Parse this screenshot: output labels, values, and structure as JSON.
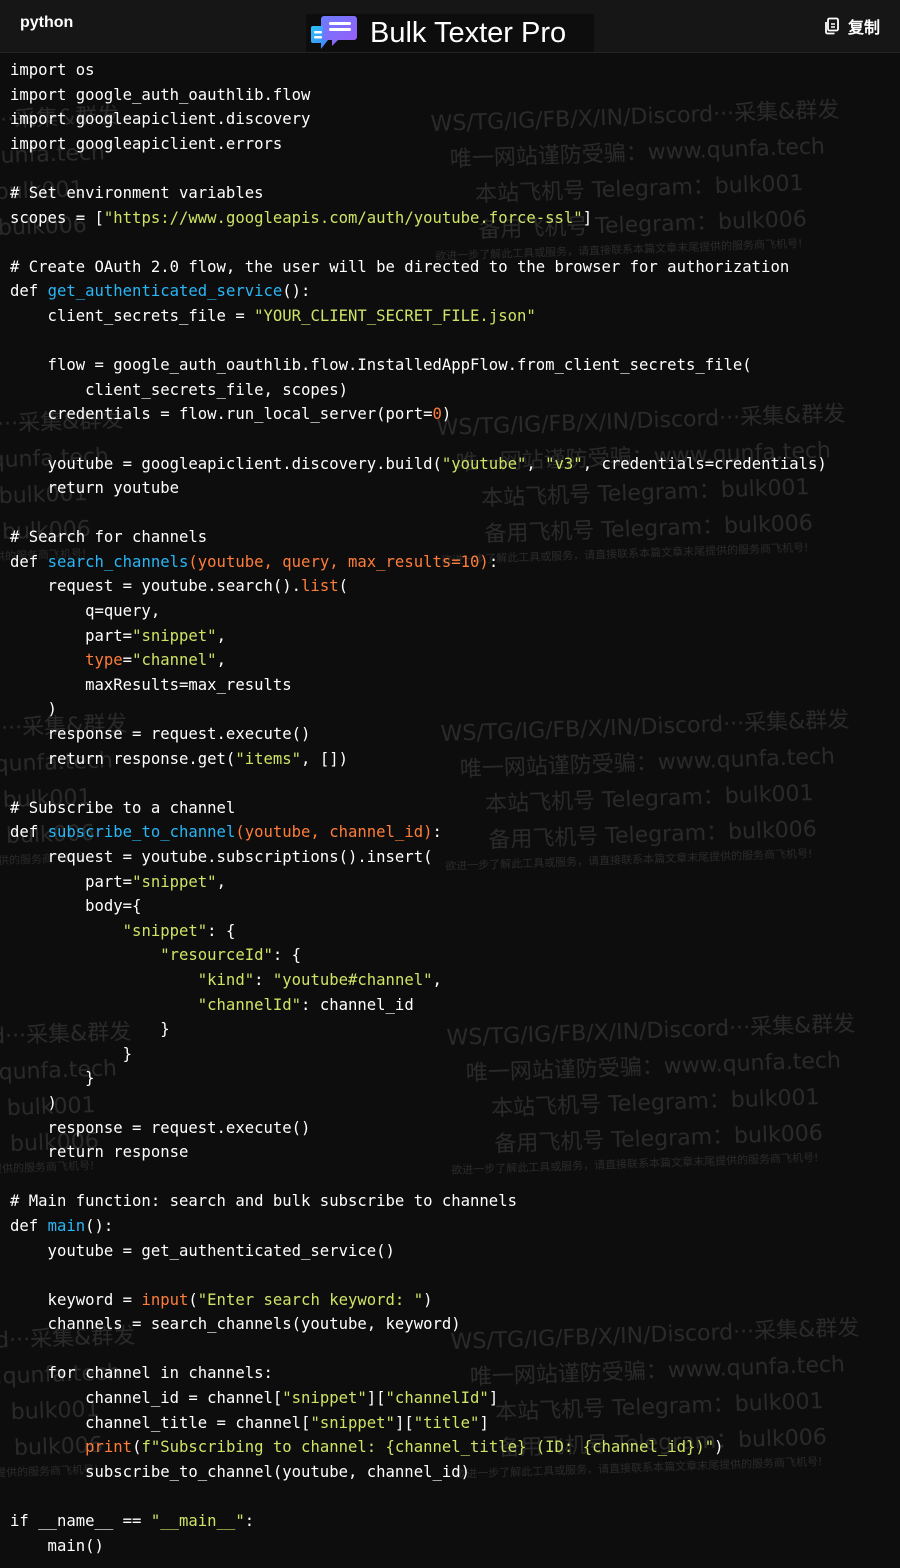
{
  "header": {
    "language": "python",
    "brand": "Bulk Texter Pro",
    "copy_label": "复制"
  },
  "watermark_lines": [
    "WS/TG/IG/FB/X/IN/Discord···采集&群发",
    "唯一网站谨防受骗：www.qunfa.tech",
    "本站飞机号 Telegram：bulk001",
    "备用飞机号 Telegram：bulk006",
    "欲进一步了解此工具或服务，请直接联系本篇文章末尾提供的服务商飞机号!"
  ],
  "code_lines": [
    [
      [
        "t",
        "import os"
      ]
    ],
    [
      [
        "t",
        "import google_auth_oauthlib.flow"
      ]
    ],
    [
      [
        "t",
        "import googleapiclient.discovery"
      ]
    ],
    [
      [
        "t",
        "import googleapiclient.errors"
      ]
    ],
    [],
    [
      [
        "t",
        "# Set environment variables"
      ]
    ],
    [
      [
        "t",
        "scopes = ["
      ],
      [
        "s",
        "\"https://www.googleapis.com/auth/youtube.force-ssl\""
      ],
      [
        "t",
        "]"
      ]
    ],
    [],
    [
      [
        "t",
        "# Create OAuth 2.0 flow, the user will be directed to the browser for authorization"
      ]
    ],
    [
      [
        "t",
        "def "
      ],
      [
        "f",
        "get_authenticated_service"
      ],
      [
        "t",
        "():"
      ]
    ],
    [
      [
        "t",
        "    client_secrets_file = "
      ],
      [
        "s",
        "\"YOUR_CLIENT_SECRET_FILE.json\""
      ]
    ],
    [],
    [
      [
        "t",
        "    flow = google_auth_oauthlib.flow.InstalledAppFlow.from_client_secrets_file("
      ]
    ],
    [
      [
        "t",
        "        client_secrets_file, scopes)"
      ]
    ],
    [
      [
        "t",
        "    credentials = flow.run_local_server(port="
      ],
      [
        "k",
        "0"
      ],
      [
        "t",
        ")"
      ]
    ],
    [],
    [
      [
        "t",
        "    youtube = googleapiclient.discovery.build("
      ],
      [
        "s",
        "\"youtube\""
      ],
      [
        "t",
        ", "
      ],
      [
        "s",
        "\"v3\""
      ],
      [
        "t",
        ", credentials=credentials)"
      ]
    ],
    [
      [
        "t",
        "    return youtube"
      ]
    ],
    [],
    [
      [
        "t",
        "# Search for channels"
      ]
    ],
    [
      [
        "t",
        "def "
      ],
      [
        "f",
        "search_channels"
      ],
      [
        "k",
        "(youtube, query, max_results=10)"
      ],
      [
        "t",
        ":"
      ]
    ],
    [
      [
        "t",
        "    request = youtube.search()."
      ],
      [
        "k",
        "list"
      ],
      [
        "t",
        "("
      ]
    ],
    [
      [
        "t",
        "        q=query,"
      ]
    ],
    [
      [
        "t",
        "        part="
      ],
      [
        "s",
        "\"snippet\""
      ],
      [
        "t",
        ","
      ]
    ],
    [
      [
        "t",
        "        "
      ],
      [
        "k",
        "type"
      ],
      [
        "t",
        "="
      ],
      [
        "s",
        "\"channel\""
      ],
      [
        "t",
        ","
      ]
    ],
    [
      [
        "t",
        "        maxResults=max_results"
      ]
    ],
    [
      [
        "t",
        "    )"
      ]
    ],
    [
      [
        "t",
        "    response = request.execute()"
      ]
    ],
    [
      [
        "t",
        "    return response.get("
      ],
      [
        "s",
        "\"items\""
      ],
      [
        "t",
        ", [])"
      ]
    ],
    [],
    [
      [
        "t",
        "# Subscribe to a channel"
      ]
    ],
    [
      [
        "t",
        "def "
      ],
      [
        "f",
        "subscribe_to_channel"
      ],
      [
        "k",
        "(youtube, channel_id)"
      ],
      [
        "t",
        ":"
      ]
    ],
    [
      [
        "t",
        "    request = youtube.subscriptions().insert("
      ]
    ],
    [
      [
        "t",
        "        part="
      ],
      [
        "s",
        "\"snippet\""
      ],
      [
        "t",
        ","
      ]
    ],
    [
      [
        "t",
        "        body={"
      ]
    ],
    [
      [
        "t",
        "            "
      ],
      [
        "s",
        "\"snippet\""
      ],
      [
        "t",
        ": {"
      ]
    ],
    [
      [
        "t",
        "                "
      ],
      [
        "s",
        "\"resourceId\""
      ],
      [
        "t",
        ": {"
      ]
    ],
    [
      [
        "t",
        "                    "
      ],
      [
        "s",
        "\"kind\""
      ],
      [
        "t",
        ": "
      ],
      [
        "s",
        "\"youtube#channel\""
      ],
      [
        "t",
        ","
      ]
    ],
    [
      [
        "t",
        "                    "
      ],
      [
        "s",
        "\"channelId\""
      ],
      [
        "t",
        ": channel_id"
      ]
    ],
    [
      [
        "t",
        "                }"
      ]
    ],
    [
      [
        "t",
        "            }"
      ]
    ],
    [
      [
        "t",
        "        }"
      ]
    ],
    [
      [
        "t",
        "    )"
      ]
    ],
    [
      [
        "t",
        "    response = request.execute()"
      ]
    ],
    [
      [
        "t",
        "    return response"
      ]
    ],
    [],
    [
      [
        "t",
        "# Main function: search and bulk subscribe to channels"
      ]
    ],
    [
      [
        "t",
        "def "
      ],
      [
        "f",
        "main"
      ],
      [
        "t",
        "():"
      ]
    ],
    [
      [
        "t",
        "    youtube = get_authenticated_service()"
      ]
    ],
    [],
    [
      [
        "t",
        "    keyword = "
      ],
      [
        "k",
        "input"
      ],
      [
        "t",
        "("
      ],
      [
        "s",
        "\"Enter search keyword: \""
      ],
      [
        "t",
        ")"
      ]
    ],
    [
      [
        "t",
        "    channels = search_channels(youtube, keyword)"
      ]
    ],
    [],
    [
      [
        "t",
        "    for channel in channels:"
      ]
    ],
    [
      [
        "t",
        "        channel_id = channel["
      ],
      [
        "s",
        "\"snippet\""
      ],
      [
        "t",
        "]["
      ],
      [
        "s",
        "\"channelId\""
      ],
      [
        "t",
        "]"
      ]
    ],
    [
      [
        "t",
        "        channel_title = channel["
      ],
      [
        "s",
        "\"snippet\""
      ],
      [
        "t",
        "]["
      ],
      [
        "s",
        "\"title\""
      ],
      [
        "t",
        "]"
      ]
    ],
    [
      [
        "t",
        "        "
      ],
      [
        "k",
        "print"
      ],
      [
        "t",
        "("
      ],
      [
        "s",
        "f\"Subscribing to channel: {channel_title} (ID: {channel_id})\""
      ],
      [
        "t",
        ")"
      ]
    ],
    [
      [
        "t",
        "        subscribe_to_channel(youtube, channel_id)"
      ]
    ],
    [],
    [
      [
        "t",
        "if __name__ == "
      ],
      [
        "s",
        "\"__main__\""
      ],
      [
        "t",
        ":"
      ]
    ],
    [
      [
        "t",
        "    main()"
      ]
    ]
  ]
}
